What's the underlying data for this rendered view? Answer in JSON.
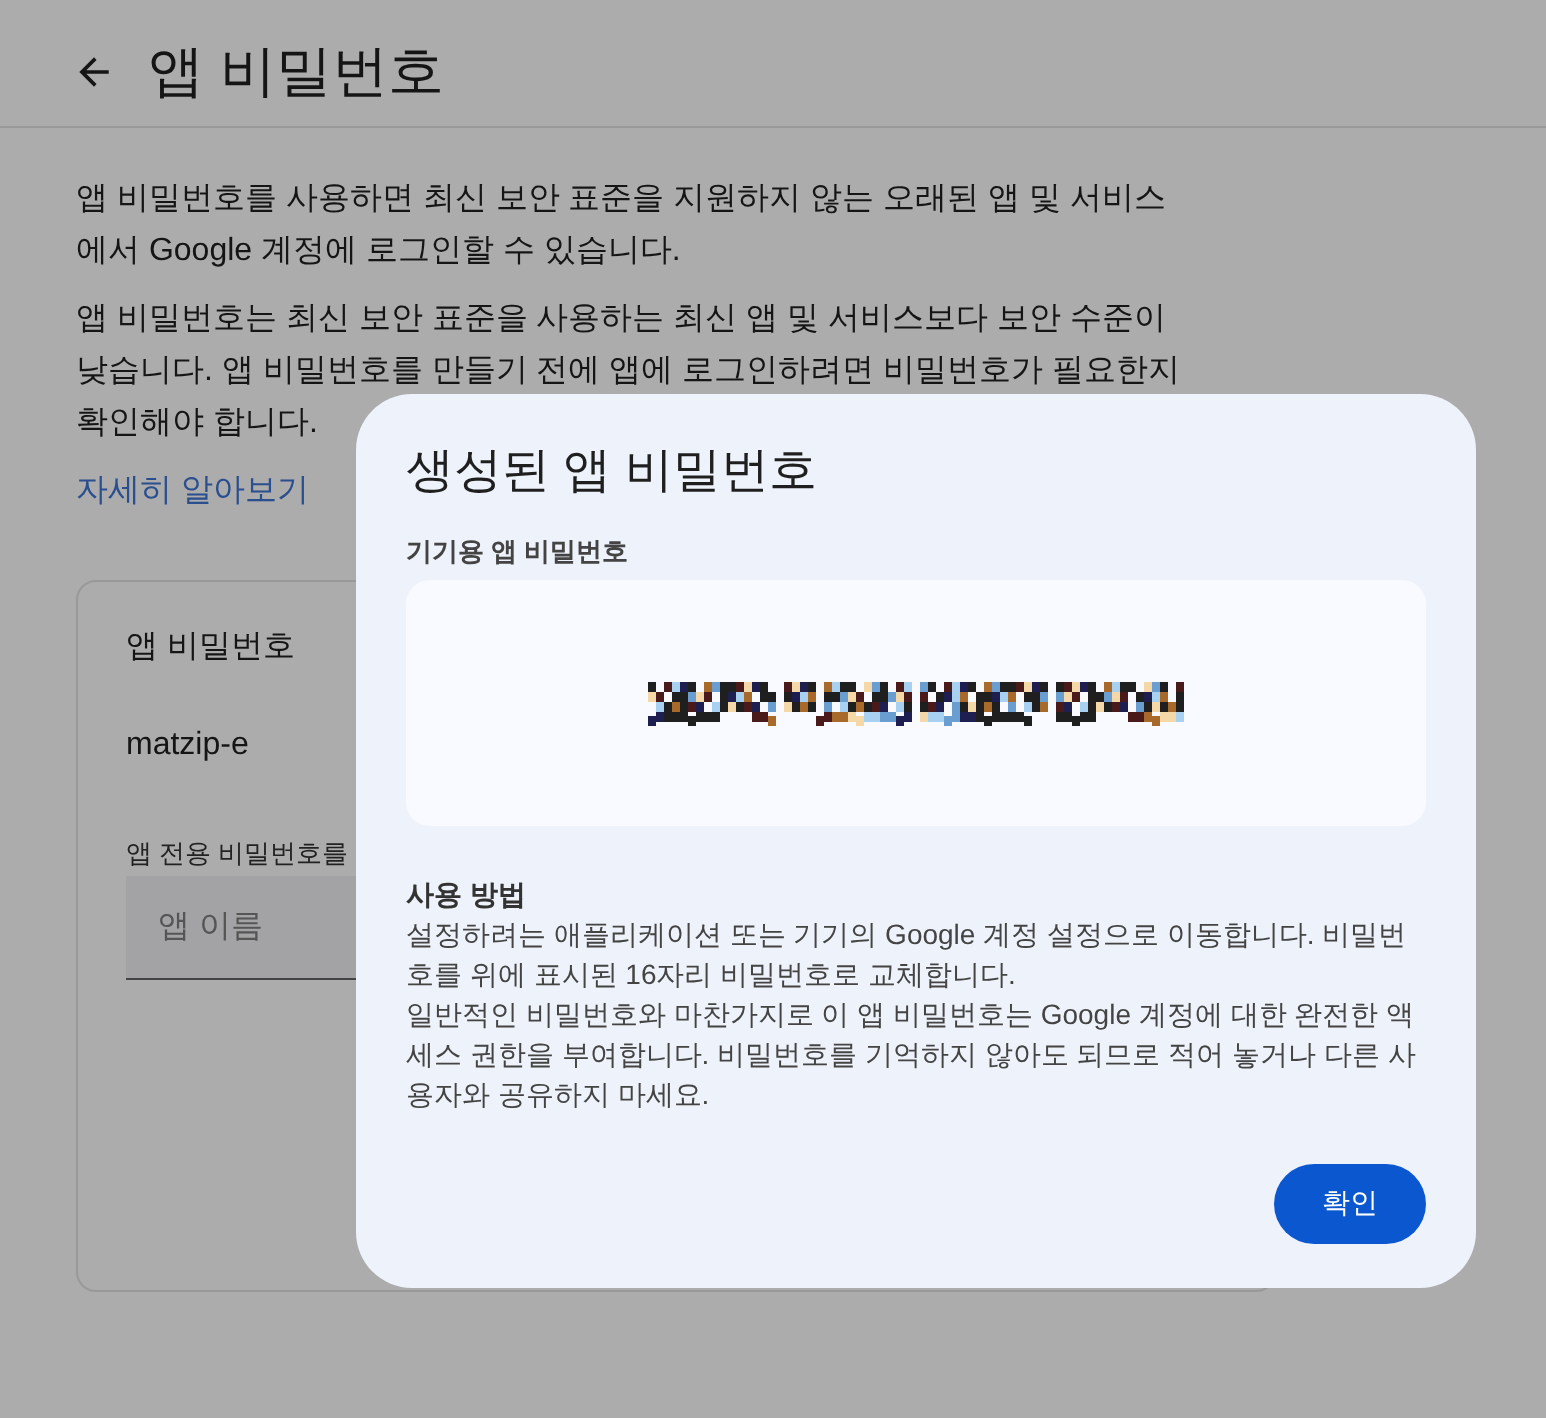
{
  "header": {
    "title": "앱 비밀번호"
  },
  "intro": [
    "앱 비밀번호를 사용하면 최신 보안 표준을 지원하지 않는 오래된 앱 및 서비스에서 Google 계정에 로그인할 수 있습니다.",
    "앱 비밀번호는 최신 보안 표준을 사용하는 최신 앱 및 서비스보다 보안 수준이 낮습니다. 앱 비밀번호를 만들기 전에 앱에 로그인하려면 비밀번호가 필요한지 확인해야 합니다."
  ],
  "learn_more_link": "자세히 알아보기",
  "card": {
    "title": "앱 비밀번호",
    "app_name": "matzip-e",
    "create_label": "앱 전용 비밀번호를",
    "field": {
      "placeholder": "앱 이름"
    }
  },
  "dialog": {
    "title": "생성된 앱 비밀번호",
    "password_label": "기기용 앱 비밀번호",
    "instructions_heading": "사용 방법",
    "instructions": [
      "설정하려는 애플리케이션 또는 기기의 Google 계정 설정으로 이동합니다. 비밀번호를 위에 표시된 16자리 비밀번호로 교체합니다.",
      "일반적인 비밀번호와 마찬가지로 이 앱 비밀번호는 Google 계정에 대한 완전한 액세스 권한을 부여합니다. 비밀번호를 기억하지 않아도 되므로 적어 놓거나 다른 사용자와 공유하지 마세요."
    ],
    "confirm_button": "확인"
  }
}
